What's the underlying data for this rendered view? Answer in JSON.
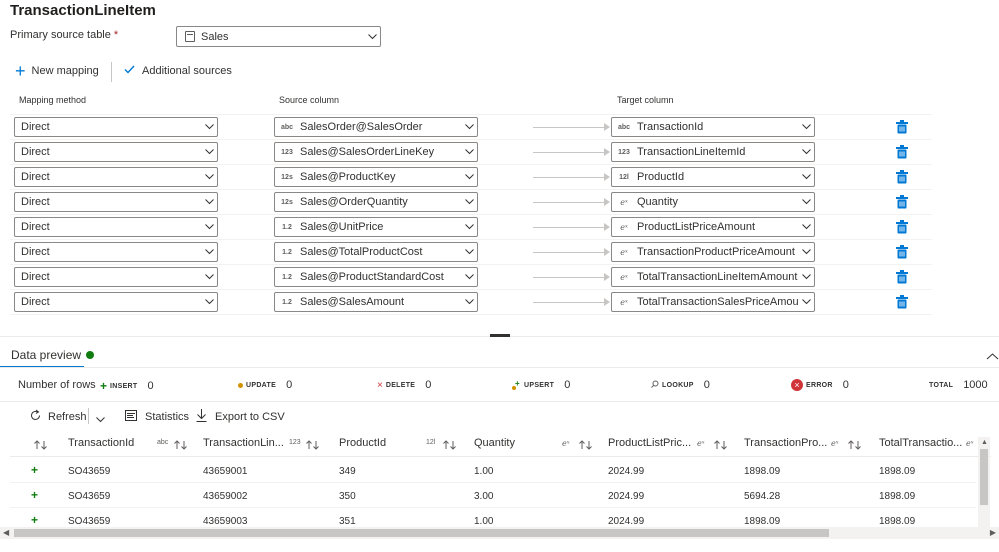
{
  "title": "TransactionLineItem",
  "primary_source": {
    "label": "Primary source table",
    "required": "*",
    "value": "Sales"
  },
  "toolbar": {
    "new_mapping": "New mapping",
    "additional_sources": "Additional sources"
  },
  "headers": {
    "method": "Mapping method",
    "source": "Source column",
    "target": "Target column"
  },
  "mappings": [
    {
      "method": "Direct",
      "src_type": "abc",
      "src": "SalesOrder@SalesOrder",
      "tgt_type": "abc",
      "tgt": "TransactionId"
    },
    {
      "method": "Direct",
      "src_type": "123",
      "src": "Sales@SalesOrderLineKey",
      "tgt_type": "123",
      "tgt": "TransactionLineItemId"
    },
    {
      "method": "Direct",
      "src_type": "12s",
      "src": "Sales@ProductKey",
      "tgt_type": "12l",
      "tgt": "ProductId"
    },
    {
      "method": "Direct",
      "src_type": "12s",
      "src": "Sales@OrderQuantity",
      "tgt_type": "eˣ",
      "tgt": "Quantity"
    },
    {
      "method": "Direct",
      "src_type": "1.2",
      "src": "Sales@UnitPrice",
      "tgt_type": "eˣ",
      "tgt": "ProductListPriceAmount"
    },
    {
      "method": "Direct",
      "src_type": "1.2",
      "src": "Sales@TotalProductCost",
      "tgt_type": "eˣ",
      "tgt": "TransactionProductPriceAmount"
    },
    {
      "method": "Direct",
      "src_type": "1.2",
      "src": "Sales@ProductStandardCost",
      "tgt_type": "eˣ",
      "tgt": "TotalTransactionLineItemAmount"
    },
    {
      "method": "Direct",
      "src_type": "1.2",
      "src": "Sales@SalesAmount",
      "tgt_type": "eˣ",
      "tgt": "TotalTransactionSalesPriceAmount"
    }
  ],
  "preview": {
    "tab": "Data preview",
    "rows_label": "Number of rows",
    "stats": [
      {
        "label": "INSERT",
        "value": "0"
      },
      {
        "label": "UPDATE",
        "value": "0"
      },
      {
        "label": "DELETE",
        "value": "0"
      },
      {
        "label": "UPSERT",
        "value": "0"
      },
      {
        "label": "LOOKUP",
        "value": "0"
      },
      {
        "label": "ERROR",
        "value": "0"
      },
      {
        "label": "TOTAL",
        "value": "1000"
      }
    ],
    "refresh": "Refresh",
    "statistics": "Statistics",
    "export": "Export to CSV",
    "columns": [
      {
        "name": "TransactionId",
        "type": "abc"
      },
      {
        "name": "TransactionLin...",
        "type": "123"
      },
      {
        "name": "ProductId",
        "type": "12l"
      },
      {
        "name": "Quantity",
        "type": "eˣ"
      },
      {
        "name": "ProductListPric...",
        "type": "eˣ"
      },
      {
        "name": "TransactionPro...",
        "type": "eˣ"
      },
      {
        "name": "TotalTransactio...",
        "type": "eˣ"
      }
    ],
    "rows": [
      [
        "SO43659",
        "43659001",
        "349",
        "1.00",
        "2024.99",
        "1898.09",
        "1898.09"
      ],
      [
        "SO43659",
        "43659002",
        "350",
        "3.00",
        "2024.99",
        "5694.28",
        "1898.09"
      ],
      [
        "SO43659",
        "43659003",
        "351",
        "1.00",
        "2024.99",
        "1898.09",
        "1898.09"
      ]
    ]
  },
  "colors": {
    "accent": "#0078d4",
    "insert": "#107c10",
    "update": "#d29200",
    "error": "#d13438",
    "dot": "#107c10"
  }
}
